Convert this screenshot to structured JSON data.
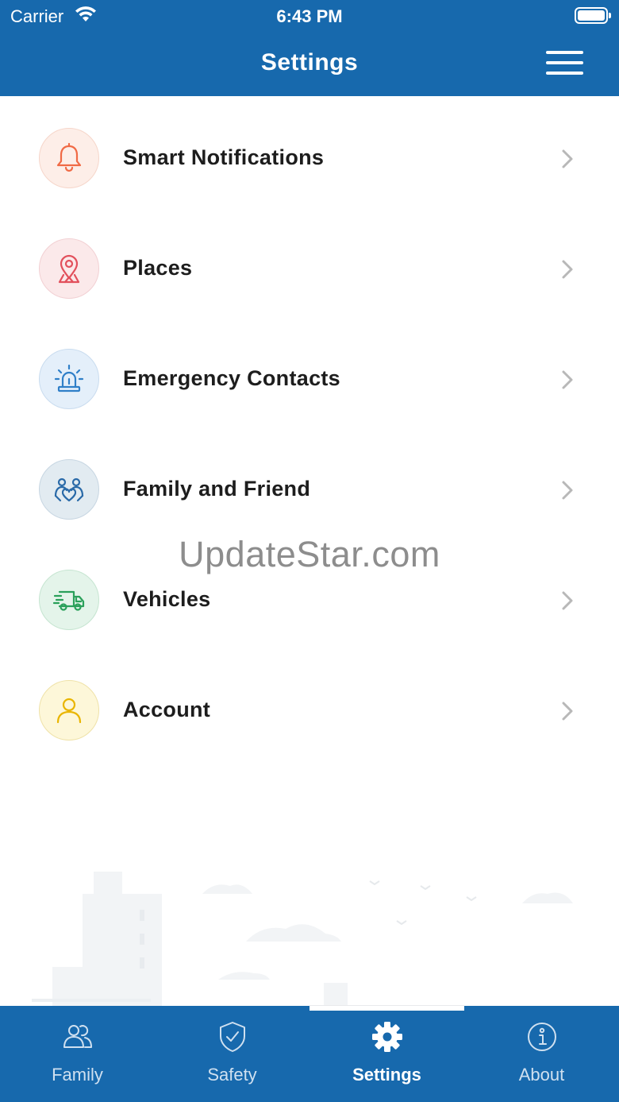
{
  "status_bar": {
    "carrier": "Carrier",
    "time": "6:43 PM"
  },
  "header": {
    "title": "Settings",
    "menu_icon": "hamburger-icon"
  },
  "settings_items": [
    {
      "label": "Smart Notifications",
      "icon": "bell-icon",
      "color": "#f06a45",
      "bg": "#fdeee8"
    },
    {
      "label": "Places",
      "icon": "map-pin-icon",
      "color": "#e2505c",
      "bg": "#fbe9ea"
    },
    {
      "label": "Emergency Contacts",
      "icon": "siren-icon",
      "color": "#2f7fc8",
      "bg": "#e4effa"
    },
    {
      "label": "Family and Friend",
      "icon": "family-icon",
      "color": "#2a6aa8",
      "bg": "#e2ebf1"
    },
    {
      "label": "Vehicles",
      "icon": "truck-icon",
      "color": "#2aa05a",
      "bg": "#e4f4ea"
    },
    {
      "label": "Account",
      "icon": "user-icon",
      "color": "#e9b500",
      "bg": "#fdf7d9"
    }
  ],
  "watermark": "UpdateStar.com",
  "tabs": [
    {
      "label": "Family",
      "icon": "family-tab-icon",
      "active": false
    },
    {
      "label": "Safety",
      "icon": "shield-check-icon",
      "active": false
    },
    {
      "label": "Settings",
      "icon": "gear-icon",
      "active": true
    },
    {
      "label": "About",
      "icon": "info-icon",
      "active": false
    }
  ],
  "colors": {
    "primary": "#1769ad",
    "text": "#1d1d1d",
    "chevron": "#b8b8b8"
  }
}
